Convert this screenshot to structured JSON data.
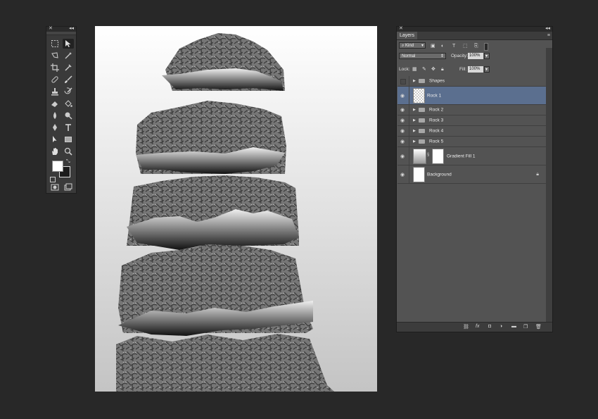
{
  "tools_panel": {
    "collapse_label": "◂◂",
    "close_label": "✕",
    "foreground_color": "#ffffff",
    "background_color": "#1c1c1c"
  },
  "layers_panel": {
    "close_label": "✕",
    "collapse_label": "◂◂",
    "tab_label": "Layers",
    "menu_label": "≡",
    "filter_kind": "Kind",
    "blend_mode": "Normal",
    "opacity_label": "Opacity:",
    "opacity_value": "100%",
    "lock_label": "Lock:",
    "fill_label": "Fill:",
    "fill_value": "100%",
    "layers": [
      {
        "name": "Shapes",
        "type": "group"
      },
      {
        "name": "Rock 1",
        "type": "layer",
        "selected": true
      },
      {
        "name": "Rock 2",
        "type": "group"
      },
      {
        "name": "Rock 3",
        "type": "group"
      },
      {
        "name": "Rock 4",
        "type": "group"
      },
      {
        "name": "Rock 5",
        "type": "group"
      },
      {
        "name": "Gradient Fill 1",
        "type": "fill"
      },
      {
        "name": "Background",
        "type": "background"
      }
    ],
    "footer_icons": [
      "link-icon",
      "fx-icon",
      "mask-icon",
      "adjustment-icon",
      "folder-icon",
      "new-layer-icon",
      "trash-icon"
    ]
  },
  "colors": {
    "app_background": "#282828",
    "panel": "#535353",
    "selection": "#5b6f8f"
  }
}
